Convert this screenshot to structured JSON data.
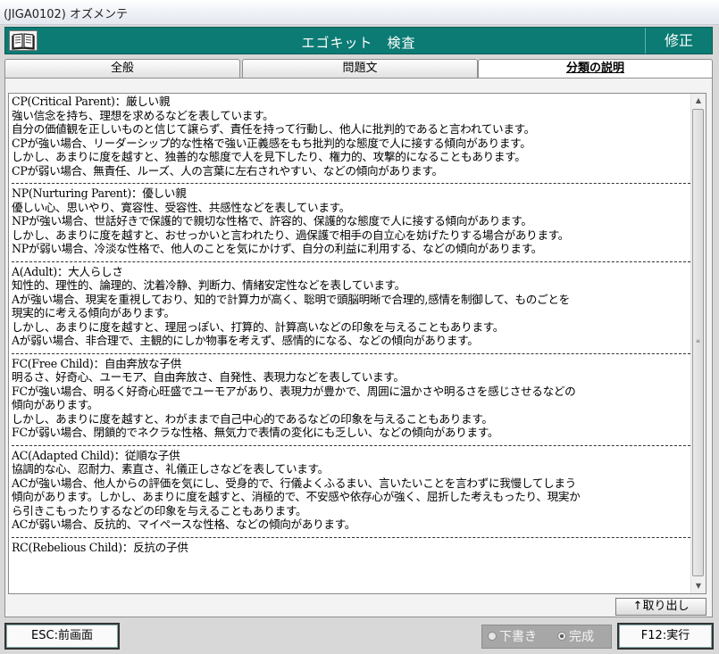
{
  "window": {
    "title": "(JIGA0102) オズメンテ"
  },
  "header": {
    "screen_title": "エゴキット　検査",
    "mode": "修正",
    "icon": "book-icon"
  },
  "tabs": [
    {
      "label": "全般",
      "active": false
    },
    {
      "label": "問題文",
      "active": false
    },
    {
      "label": "分類の説明",
      "active": true
    }
  ],
  "sections": [
    {
      "heading": "CP(Critical Parent)：厳しい親",
      "lines": [
        "強い信念を持ち、理想を求めるなどを表しています。",
        "自分の価値観を正しいものと信じて譲らず、責任を持って行動し、他人に批判的であると言われています。",
        "CPが強い場合、リーダーシップ的な性格で強い正義感をもち批判的な態度で人に接する傾向があります。",
        "しかし、あまりに度を越すと、独善的な態度で人を見下したり、権力的、攻撃的になることもあります。",
        "CPが弱い場合、無責任、ルーズ、人の言葉に左右されやすい、などの傾向があります。"
      ]
    },
    {
      "heading": "NP(Nurturing Parent)：優しい親",
      "lines": [
        "優しい心、思いやり、寛容性、受容性、共感性などを表しています。",
        "NPが強い場合、世話好きで保護的で親切な性格で、許容的、保護的な態度で人に接する傾向があります。",
        "しかし、あまりに度を越すと、おせっかいと言われたり、過保護で相手の自立心を妨げたりする場合があります。",
        "NPが弱い場合、冷淡な性格で、他人のことを気にかけず、自分の利益に利用する、などの傾向があります。"
      ]
    },
    {
      "heading": "A(Adult)：大人らしさ",
      "lines": [
        "知性的、理性的、論理的、沈着冷静、判断力、情緒安定性などを表しています。",
        "Aが強い場合、現実を重視しており、知的で計算力が高く、聡明で頭脳明晰で合理的,感情を制御して、ものごとを",
        "現実的に考える傾向があります。",
        "しかし、あまりに度を越すと、理屈っぽい、打算的、計算高いなどの印象を与えることもあります。",
        "Aが弱い場合、非合理で、主観的にしか物事を考えず、感情的になる、などの傾向があります。"
      ]
    },
    {
      "heading": "FC(Free Child)：自由奔放な子供",
      "lines": [
        "明るさ、好奇心、ユーモア、自由奔放さ、自発性、表現力などを表しています。",
        "FCが強い場合、明るく好奇心旺盛でユーモアがあり、表現力が豊かで、周囲に温かさや明るさを感じさせるなどの",
        "傾向があります。",
        "しかし、あまりに度を越すと、わがままで自己中心的であるなどの印象を与えることもあります。",
        "FCが弱い場合、閉鎖的でネクラな性格、無気力で表情の変化にも乏しい、などの傾向があります。"
      ]
    },
    {
      "heading": "AC(Adapted Child)：従順な子供",
      "lines": [
        "協調的な心、忍耐力、素直さ、礼儀正しさなどを表しています。",
        "ACが強い場合、他人からの評価を気にし、受身的で、行儀よくふるまい、言いたいことを言わずに我慢してしまう",
        "傾向があります。しかし、あまりに度を越すと、消極的で、不安感や依存心が強く、屈折した考えもったり、現実か",
        "ら引きこもったりするなどの印象を与えることもあります。",
        "ACが弱い場合、反抗的、マイペースな性格、などの傾向があります。"
      ]
    },
    {
      "heading": "RC(Rebelious Child)：反抗の子供",
      "lines": []
    }
  ],
  "buttons": {
    "extract": "↑取り出し",
    "esc": "ESC:前画面",
    "f12": "F12:実行"
  },
  "status": {
    "draft": "下書き",
    "complete": "完成",
    "selected": "complete"
  }
}
